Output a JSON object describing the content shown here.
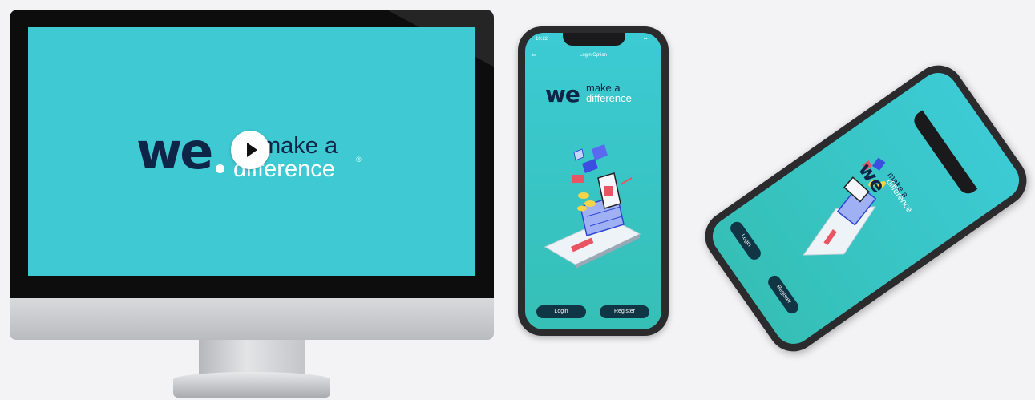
{
  "monitor": {
    "logo_we": "we",
    "tagline_line1": "make a",
    "tagline_line2": "difference",
    "registered_mark": "®",
    "play_label": "Play video"
  },
  "phone": {
    "status_time": "10:22",
    "title": "Login Option",
    "logo_we": "we",
    "tagline_line1": "make a",
    "tagline_line2": "difference",
    "login_label": "Login",
    "register_label": "Register"
  },
  "landscape_phone": {
    "logo_we": "we",
    "tagline_line1": "make a",
    "tagline_line2": "difference",
    "login_label": "Login",
    "register_label": "Register"
  },
  "colors": {
    "screen_teal": "#3ec9d3",
    "logo_navy": "#0f2547",
    "button_dark": "#103545",
    "background": "#f3f3f5"
  }
}
